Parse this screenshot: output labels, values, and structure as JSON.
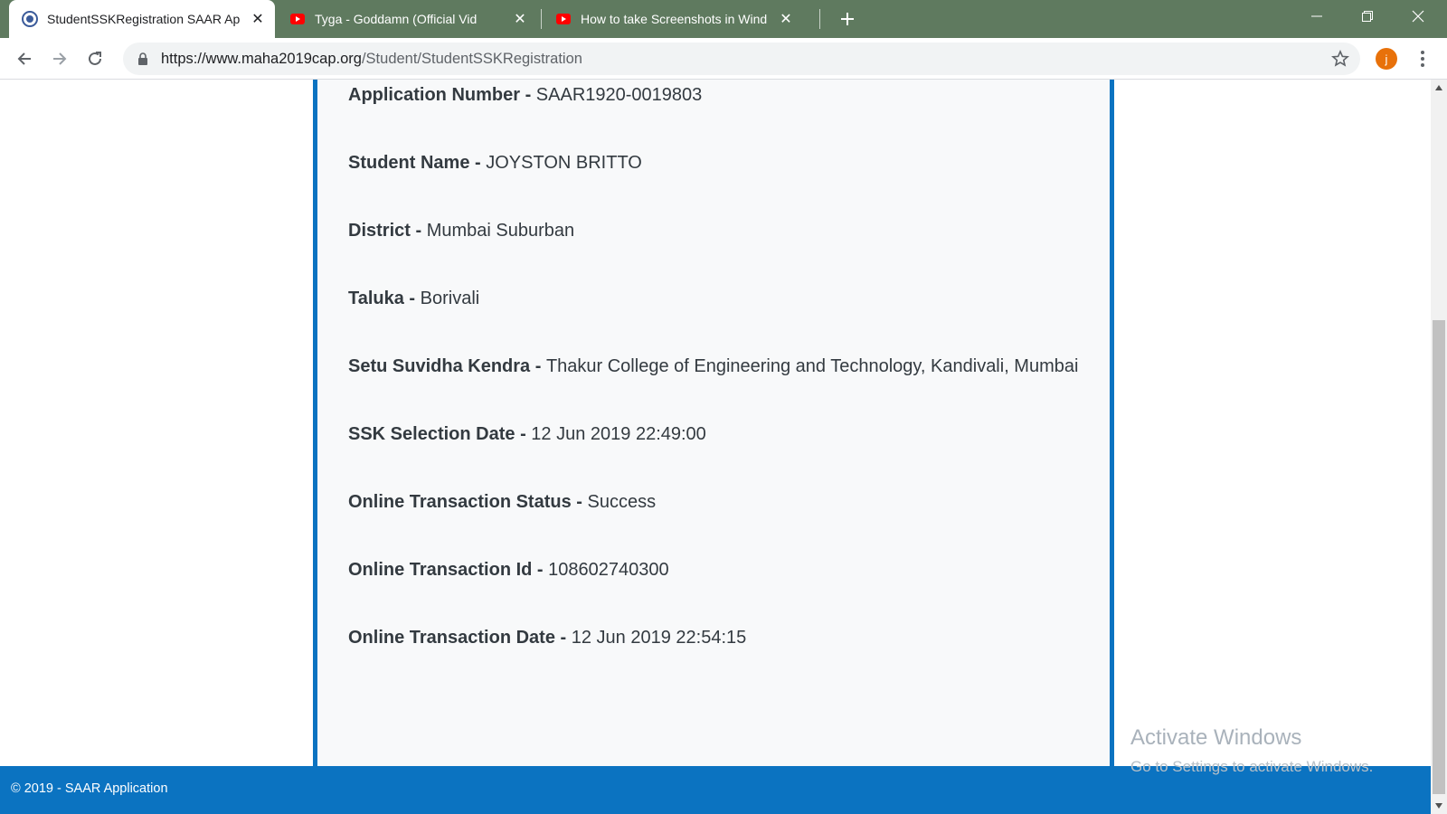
{
  "browser": {
    "tabs": [
      {
        "title": "StudentSSKRegistration SAAR Ap",
        "active": true,
        "icon": "saar-favicon"
      },
      {
        "title": "Tyga - Goddamn (Official Vid",
        "active": false,
        "icon": "youtube-icon"
      },
      {
        "title": "How to take Screenshots in Wind",
        "active": false,
        "icon": "youtube-icon"
      }
    ],
    "url_host": "https://www.maha2019cap.org",
    "url_path": "/Student/StudentSSKRegistration",
    "profile_initial": "j"
  },
  "details": [
    {
      "label": "Application Number",
      "value": "SAAR1920-0019803"
    },
    {
      "label": "Student Name",
      "value": "JOYSTON BRITTO"
    },
    {
      "label": "District",
      "value": "Mumbai Suburban"
    },
    {
      "label": "Taluka",
      "value": "Borivali"
    },
    {
      "label": "Setu Suvidha Kendra",
      "value": "Thakur College of Engineering and Technology, Kandivali, Mumbai"
    },
    {
      "label": "SSK Selection Date",
      "value": "12 Jun 2019 22:49:00"
    },
    {
      "label": "Online Transaction Status",
      "value": "Success"
    },
    {
      "label": "Online Transaction Id",
      "value": "108602740300"
    },
    {
      "label": "Online Transaction Date",
      "value": "12 Jun 2019 22:54:15"
    }
  ],
  "separator": " - ",
  "footer": {
    "text": "© 2019 - SAAR Application"
  },
  "watermark": {
    "title": "Activate Windows",
    "subtitle": "Go to Settings to activate Windows."
  },
  "colors": {
    "accent": "#0b73c1",
    "tabbar": "#5f7a5f",
    "avatar": "#e8710a"
  }
}
